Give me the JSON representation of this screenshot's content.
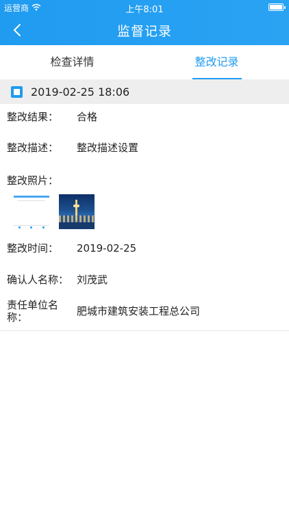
{
  "status_bar": {
    "carrier": "运营商",
    "time": "上午8:01"
  },
  "nav": {
    "title": "监督记录"
  },
  "tabs": [
    {
      "label": "检查详情",
      "active": false
    },
    {
      "label": "整改记录",
      "active": true
    }
  ],
  "record": {
    "datetime": "2019-02-25 18:06"
  },
  "fields": {
    "result": {
      "label": "整改结果：",
      "value": "合格"
    },
    "description": {
      "label": "整改描述：",
      "value": "整改描述设置"
    },
    "photos": {
      "label": "整改照片：",
      "count": 2
    },
    "time": {
      "label": "整改时间：",
      "value": "2019-02-25"
    },
    "confirmer": {
      "label": "确认人名称：",
      "value": "刘茂武"
    },
    "unit": {
      "label": "责任单位名称：",
      "value": "肥城市建筑安装工程总公司"
    }
  },
  "colors": {
    "accent": "#1f9bf0",
    "section_bg": "#eeeeee"
  }
}
